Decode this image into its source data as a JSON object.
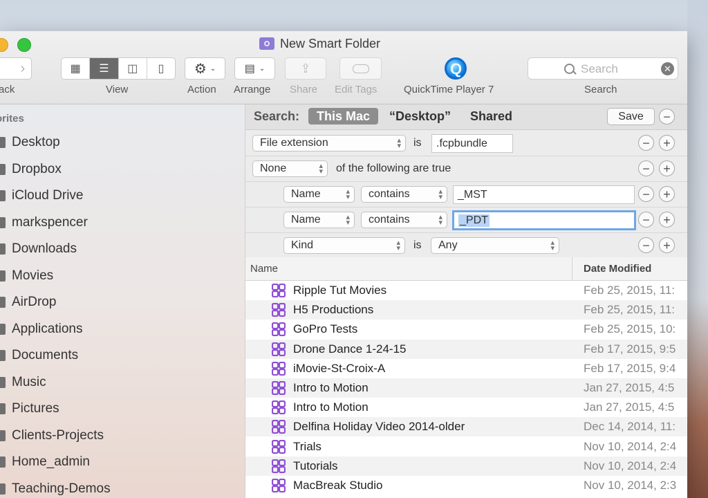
{
  "window": {
    "title": "New Smart Folder"
  },
  "toolbar": {
    "back_label": "ack",
    "view_label": "View",
    "action_label": "Action",
    "arrange_label": "Arrange",
    "share_label": "Share",
    "edit_tags_label": "Edit Tags",
    "quicktime_label": "QuickTime Player 7",
    "search_label": "Search",
    "search_placeholder": "Search",
    "view_modes": [
      "icon",
      "list",
      "column",
      "cover-flow"
    ],
    "active_view": "list"
  },
  "sidebar": {
    "header": "orites",
    "items": [
      {
        "label": "Desktop"
      },
      {
        "label": "Dropbox"
      },
      {
        "label": "iCloud Drive"
      },
      {
        "label": "markspencer"
      },
      {
        "label": "Downloads"
      },
      {
        "label": "Movies"
      },
      {
        "label": "AirDrop"
      },
      {
        "label": "Applications"
      },
      {
        "label": "Documents"
      },
      {
        "label": "Music"
      },
      {
        "label": "Pictures"
      },
      {
        "label": "Clients-Projects"
      },
      {
        "label": "Home_admin"
      },
      {
        "label": "Teaching-Demos"
      }
    ]
  },
  "search_scope": {
    "label": "Search:",
    "this_mac": "This Mac",
    "desktop": "“Desktop”",
    "shared": "Shared",
    "save": "Save"
  },
  "criteria": {
    "row1": {
      "attribute": "File extension",
      "operator": "is",
      "value": ".fcpbundle"
    },
    "row2": {
      "quantifier": "None",
      "text": "of the following are true"
    },
    "row3": {
      "attribute": "Name",
      "operator": "contains",
      "value": "_MST"
    },
    "row4": {
      "attribute": "Name",
      "operator": "contains",
      "value": "_PDT"
    },
    "row5": {
      "attribute": "Kind",
      "operator": "is",
      "value": "Any"
    }
  },
  "results": {
    "col_name": "Name",
    "col_date": "Date Modified",
    "rows": [
      {
        "name": "Ripple Tut Movies",
        "date": "Feb 25, 2015, 11:"
      },
      {
        "name": "H5 Productions",
        "date": "Feb 25, 2015, 11:"
      },
      {
        "name": "GoPro Tests",
        "date": "Feb 25, 2015, 10:"
      },
      {
        "name": "Drone Dance 1-24-15",
        "date": "Feb 17, 2015, 9:5"
      },
      {
        "name": "iMovie-St-Croix-A",
        "date": "Feb 17, 2015, 9:4"
      },
      {
        "name": "Intro to Motion",
        "date": "Jan 27, 2015, 4:5"
      },
      {
        "name": "Intro to Motion",
        "date": "Jan 27, 2015, 4:5"
      },
      {
        "name": "Delfina Holiday Video 2014-older",
        "date": "Dec 14, 2014, 11:"
      },
      {
        "name": "Trials",
        "date": "Nov 10, 2014, 2:4"
      },
      {
        "name": "Tutorials",
        "date": "Nov 10, 2014, 2:4"
      },
      {
        "name": "MacBreak Studio",
        "date": "Nov 10, 2014, 2:3"
      }
    ]
  },
  "colors": {
    "accent_focus": "#6ea6e8",
    "library_icon": "#8e4fd6",
    "scope_active": "#8d8d8d"
  }
}
